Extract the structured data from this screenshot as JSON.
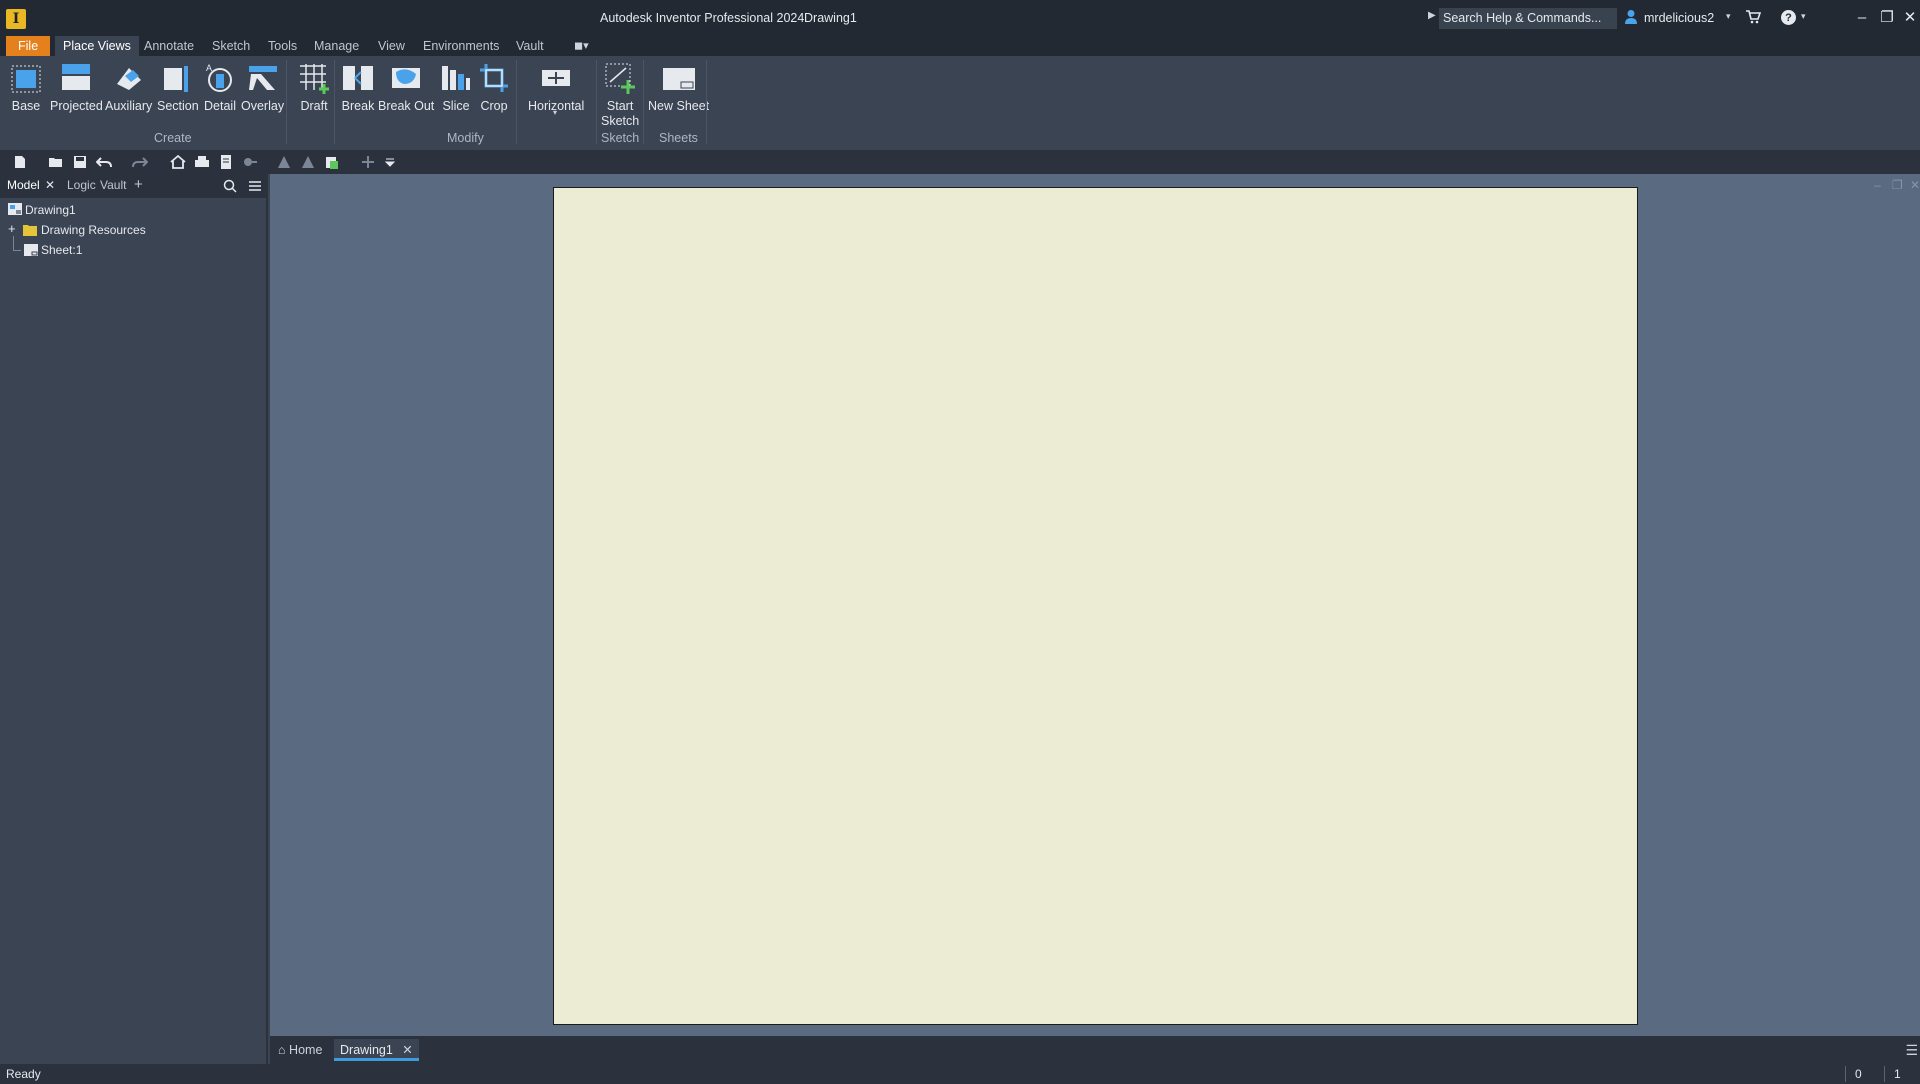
{
  "titlebar": {
    "app_logo": "I",
    "title": "Autodesk Inventor Professional 2024",
    "document": "Drawing1",
    "search_placeholder": "Search Help & Commands...",
    "user": "mrdelicious2"
  },
  "ribbon_tabs": [
    {
      "label": "File"
    },
    {
      "label": "Place Views"
    },
    {
      "label": "Annotate"
    },
    {
      "label": "Sketch"
    },
    {
      "label": "Tools"
    },
    {
      "label": "Manage"
    },
    {
      "label": "View"
    },
    {
      "label": "Environments"
    },
    {
      "label": "Vault"
    }
  ],
  "ribbon": {
    "create": {
      "label": "Create",
      "buttons": [
        "Base",
        "Projected",
        "Auxiliary",
        "Section",
        "Detail",
        "Overlay",
        "Draft"
      ]
    },
    "modify": {
      "label": "Modify",
      "buttons": [
        "Break",
        "Break Out",
        "Slice",
        "Crop",
        "Horizontal"
      ]
    },
    "sketch": {
      "label": "Sketch",
      "button_line1": "Start",
      "button_line2": "Sketch"
    },
    "sheets": {
      "label": "Sheets",
      "button": "New Sheet"
    }
  },
  "browser": {
    "tabs": [
      "Model",
      "Logic",
      "Vault"
    ],
    "tree": [
      {
        "label": "Drawing1"
      },
      {
        "label": "Drawing Resources"
      },
      {
        "label": "Sheet:1"
      }
    ]
  },
  "doc_tabs": {
    "home": "Home",
    "document": "Drawing1"
  },
  "status": {
    "text": "Ready",
    "count1": "0",
    "count2": "1"
  },
  "colors": {
    "file_tab": "#e4811d",
    "sheet": "#ecebd4",
    "canvas": "#5a6a80",
    "accent": "#3e9be0"
  }
}
